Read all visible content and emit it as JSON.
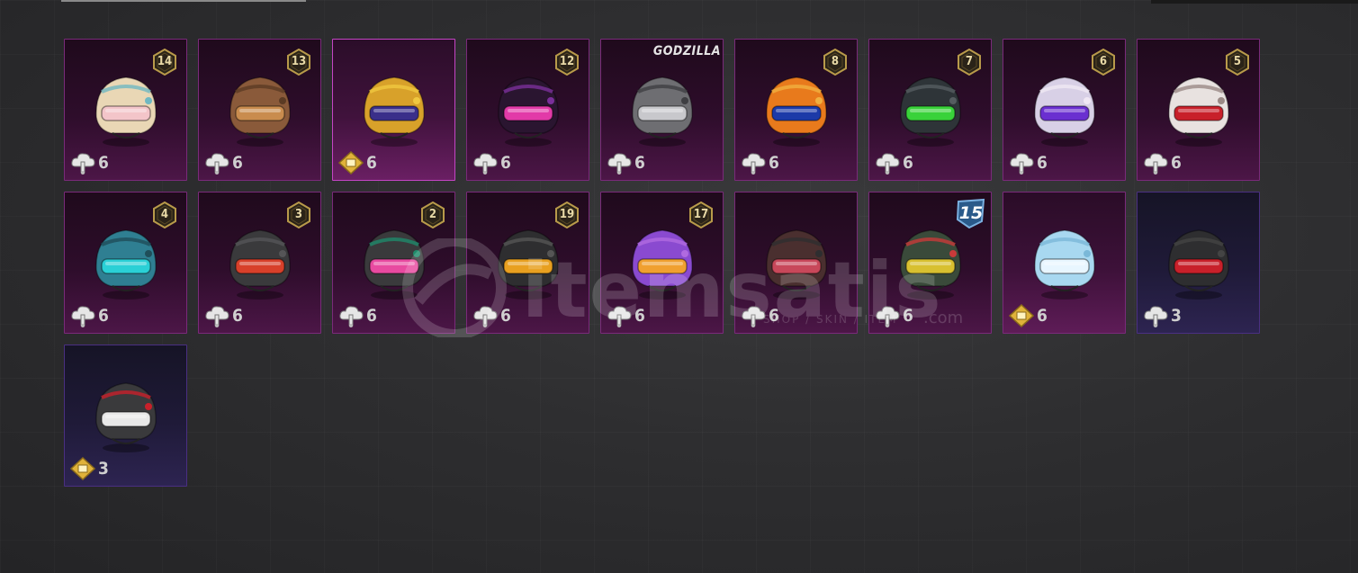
{
  "inventory": {
    "items": [
      {
        "name": "cat-helmet",
        "level": "14",
        "count": "6",
        "currency": "cloud"
      },
      {
        "name": "steampunk-helmet",
        "level": "13",
        "count": "6",
        "currency": "cloud"
      },
      {
        "name": "pharaoh-helmet",
        "level": "",
        "count": "6",
        "currency": "gold"
      },
      {
        "name": "neon-bunny-helmet",
        "level": "12",
        "count": "6",
        "currency": "cloud"
      },
      {
        "name": "godzilla-helmet",
        "level": "",
        "count": "6",
        "currency": "cloud",
        "brand": "GODZILLA"
      },
      {
        "name": "clownfish-helmet",
        "level": "8",
        "count": "6",
        "currency": "cloud"
      },
      {
        "name": "green-visor-helmet",
        "level": "7",
        "count": "6",
        "currency": "cloud"
      },
      {
        "name": "purple-flame-helmet",
        "level": "6",
        "count": "6",
        "currency": "cloud"
      },
      {
        "name": "samurai-helmet",
        "level": "5",
        "count": "6",
        "currency": "cloud"
      },
      {
        "name": "cyclops-helmet",
        "level": "4",
        "count": "6",
        "currency": "cloud"
      },
      {
        "name": "red-visor-helmet",
        "level": "3",
        "count": "6",
        "currency": "cloud"
      },
      {
        "name": "pink-punk-helmet",
        "level": "2",
        "count": "6",
        "currency": "cloud"
      },
      {
        "name": "shark-helmet",
        "level": "19",
        "count": "6",
        "currency": "cloud"
      },
      {
        "name": "purple-fluffy-helmet",
        "level": "17",
        "count": "6",
        "currency": "cloud"
      },
      {
        "name": "dragon-helmet",
        "level": "",
        "count": "6",
        "currency": "cloud"
      },
      {
        "name": "robot-helmet",
        "level": "",
        "count": "6",
        "currency": "cloud",
        "tier": "15"
      },
      {
        "name": "ice-helmet",
        "level": "",
        "count": "6",
        "currency": "gold"
      },
      {
        "name": "red-stripe-helmet",
        "level": "",
        "count": "3",
        "currency": "cloud"
      },
      {
        "name": "led-helmet",
        "level": "",
        "count": "3",
        "currency": "gold"
      }
    ]
  },
  "watermark": {
    "text": "itemsatis",
    "sub": "SHOP / SKIN / ITEM",
    "suffix": ".com"
  },
  "colors": {
    "slot_border": "#7a2a7a",
    "slot_bg": "#3a0f36",
    "badge": "#e8d9a6",
    "accent": "#c445c4"
  }
}
